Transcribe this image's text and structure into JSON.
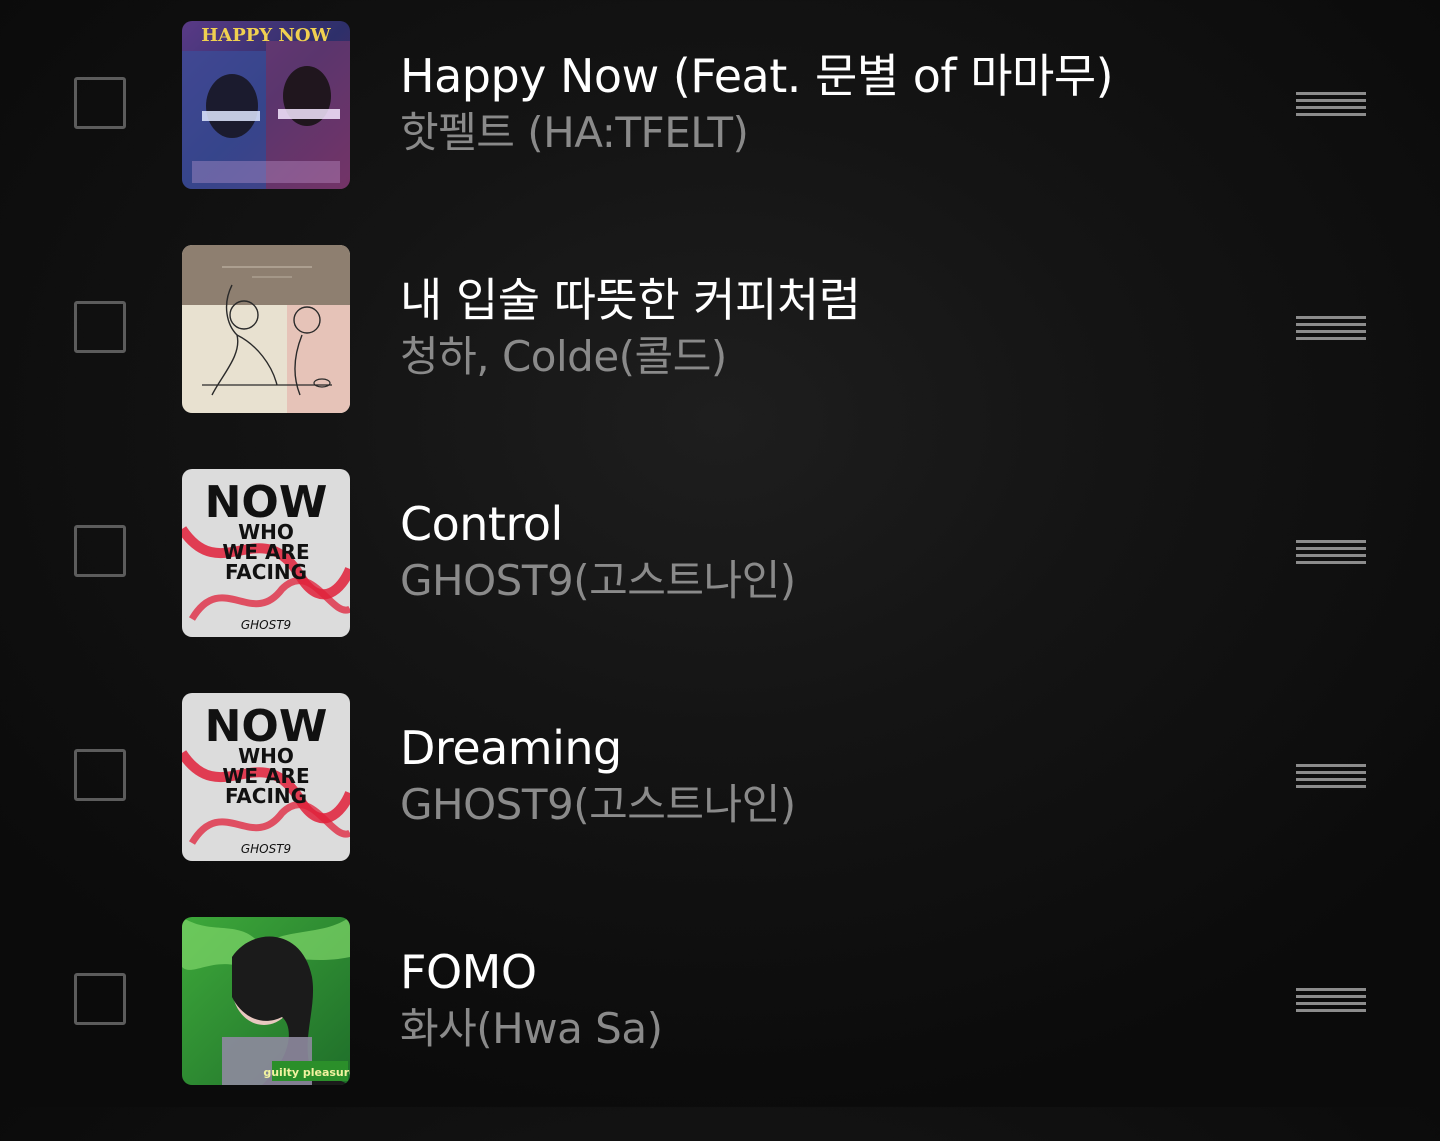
{
  "tracks": [
    {
      "title": "Happy Now (Feat. 문별 of 마마무)",
      "artist": "핫펠트 (HA:TFELT)",
      "art_text": "HAPPY NOW",
      "art_icon": "album-art-happy-now"
    },
    {
      "title": "내 입술 따뜻한 커피처럼",
      "artist": "청하, Colde(콜드)",
      "art_icon": "album-art-sketch-couple"
    },
    {
      "title": "Control",
      "artist": "GHOST9(고스트나인)",
      "art_text": "NOW",
      "art_subtext": [
        "WHO",
        "WE ARE",
        "FACING"
      ],
      "art_brand": "GHOST9",
      "art_icon": "album-art-now-who-we-are-facing"
    },
    {
      "title": "Dreaming",
      "artist": "GHOST9(고스트나인)",
      "art_text": "NOW",
      "art_subtext": [
        "WHO",
        "WE ARE",
        "FACING"
      ],
      "art_brand": "GHOST9",
      "art_icon": "album-art-now-who-we-are-facing"
    },
    {
      "title": "FOMO",
      "artist": "화사(Hwa Sa)",
      "art_text": "guilty pleasure",
      "art_icon": "album-art-guilty-pleasure"
    }
  ],
  "colors": {
    "background": "#111111",
    "title": "#ffffff",
    "artist": "#8a8a8a",
    "checkbox_border": "#5c5c5c",
    "handle": "#8c8c8c"
  }
}
